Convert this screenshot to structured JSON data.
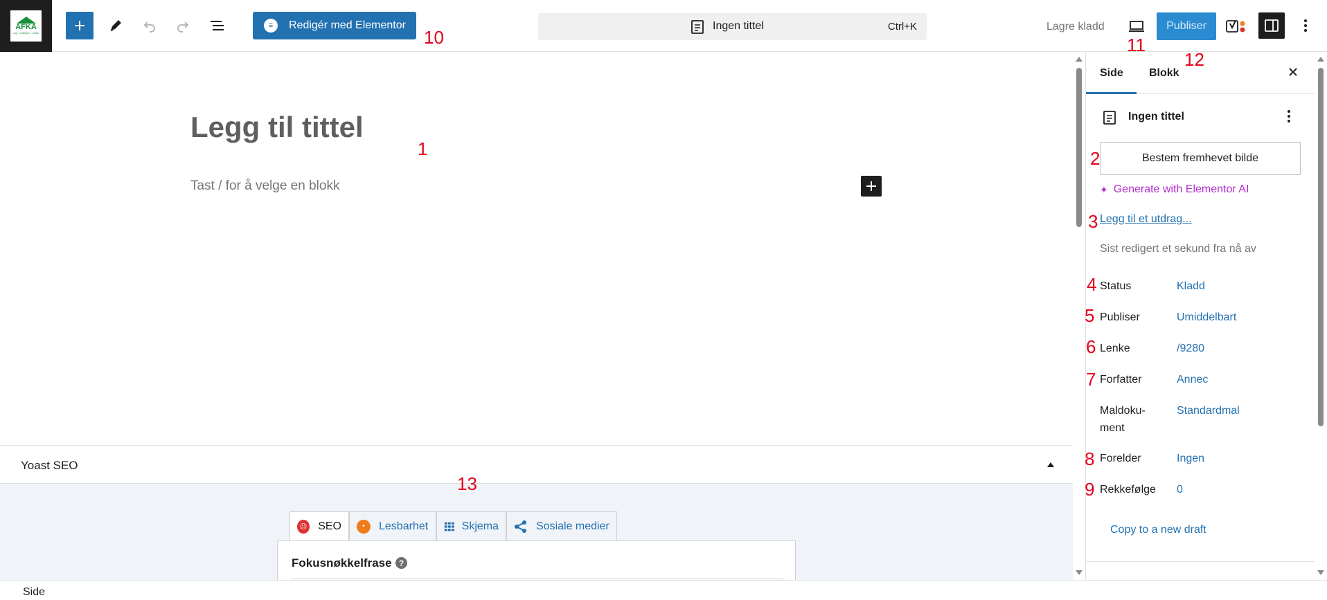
{
  "app": {
    "logo_text": "AFKA",
    "logo_sub": "ung . tradisjon . kultur"
  },
  "toolbar": {
    "elementor_label": "Redigér med Elementor",
    "document_title": "Ingen tittel",
    "shortcut": "Ctrl+K",
    "save_draft": "Lagre kladd",
    "publish": "Publiser",
    "accent": "#2271b1"
  },
  "editor": {
    "title_placeholder": "Legg til tittel",
    "block_placeholder": "Tast / for å velge en blokk"
  },
  "yoast": {
    "header": "Yoast SEO",
    "tabs": [
      {
        "label": "SEO",
        "icon": "sad-face-icon",
        "color": "#dc3232"
      },
      {
        "label": "Lesbarhet",
        "icon": "neutral-face-icon",
        "color": "#ee7c1b"
      },
      {
        "label": "Skjema",
        "icon": "grid-icon",
        "color": "#2271b1"
      },
      {
        "label": "Sosiale medier",
        "icon": "share-icon",
        "color": "#2271b1"
      }
    ],
    "focus_label": "Fokusnøkkelfrase"
  },
  "sidebar": {
    "tabs": [
      "Side",
      "Blokk"
    ],
    "doc_title": "Ingen tittel",
    "featured_image": "Bestem fremhevet bilde",
    "ai_link": "Generate with Elementor AI",
    "excerpt_link": "Legg til et utdrag...",
    "last_edited": "Sist redigert et sekund fra nå av",
    "properties": [
      {
        "key": "Status",
        "value": "Kladd"
      },
      {
        "key": "Publiser",
        "value": "Umiddelbart"
      },
      {
        "key": "Lenke",
        "value": "/9280"
      },
      {
        "key": "Forfatter",
        "value": "Annec"
      },
      {
        "key": "Maldoku-",
        "key2": "ment",
        "value": "Standardmal"
      },
      {
        "key": "Forelder",
        "value": "Ingen"
      },
      {
        "key": "Rekkefølge",
        "value": "0"
      }
    ],
    "copy_link": "Copy to a new draft"
  },
  "footer": {
    "breadcrumb": "Side"
  },
  "annotations": [
    "1",
    "2",
    "3",
    "4",
    "5",
    "6",
    "7",
    "8",
    "9",
    "10",
    "11",
    "12",
    "13"
  ]
}
